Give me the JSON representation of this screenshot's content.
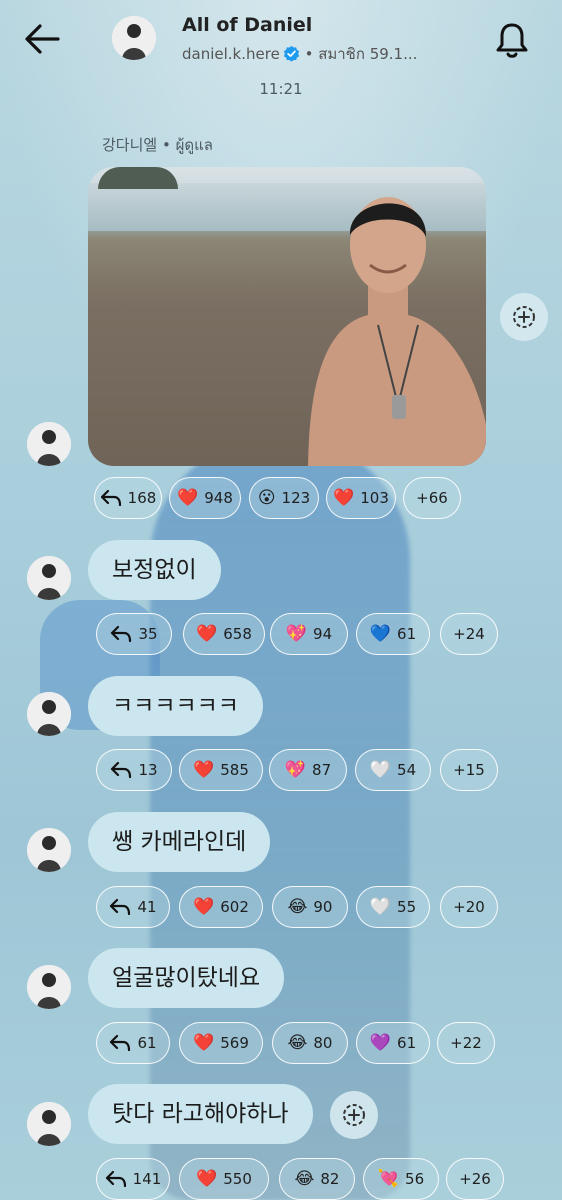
{
  "header": {
    "title": "All of Daniel",
    "handle": "daniel.k.here",
    "members": "• สมาชิก 59.1..."
  },
  "chat": {
    "time": "11:21",
    "sender": "강다니엘 • ผู้ดูแล"
  },
  "messages": [
    {
      "type": "photo",
      "reactions": [
        {
          "kind": "reply",
          "count": "168"
        },
        {
          "emoji": "❤️",
          "count": "948"
        },
        {
          "emoji": "😮",
          "count": "123"
        },
        {
          "emoji": "❤️",
          "count": "103"
        },
        {
          "kind": "more",
          "count": "+66"
        }
      ]
    },
    {
      "text": "보정없이",
      "reactions": [
        {
          "kind": "reply",
          "count": "35"
        },
        {
          "emoji": "❤️",
          "count": "658"
        },
        {
          "emoji": "💖",
          "count": "94"
        },
        {
          "emoji": "💙",
          "count": "61"
        },
        {
          "kind": "more",
          "count": "+24"
        }
      ]
    },
    {
      "text": "ㅋㅋㅋㅋㅋㅋ",
      "reactions": [
        {
          "kind": "reply",
          "count": "13"
        },
        {
          "emoji": "❤️",
          "count": "585"
        },
        {
          "emoji": "💖",
          "count": "87"
        },
        {
          "emoji": "🤍",
          "count": "54"
        },
        {
          "kind": "more",
          "count": "+15"
        }
      ]
    },
    {
      "text": "쌩 카메라인데",
      "reactions": [
        {
          "kind": "reply",
          "count": "41"
        },
        {
          "emoji": "❤️",
          "count": "602"
        },
        {
          "emoji": "😂",
          "count": "90"
        },
        {
          "emoji": "🤍",
          "count": "55"
        },
        {
          "kind": "more",
          "count": "+20"
        }
      ]
    },
    {
      "text": "얼굴많이탔네요",
      "reactions": [
        {
          "kind": "reply",
          "count": "61"
        },
        {
          "emoji": "❤️",
          "count": "569"
        },
        {
          "emoji": "😂",
          "count": "80"
        },
        {
          "emoji": "💜",
          "count": "61"
        },
        {
          "kind": "more",
          "count": "+22"
        }
      ]
    },
    {
      "text": "탓다 라고해야하나",
      "reactions": [
        {
          "kind": "reply",
          "count": "141"
        },
        {
          "emoji": "❤️",
          "count": "550"
        },
        {
          "emoji": "😂",
          "count": "82"
        },
        {
          "emoji": "💘",
          "count": "56"
        },
        {
          "kind": "more",
          "count": "+26"
        }
      ]
    }
  ]
}
